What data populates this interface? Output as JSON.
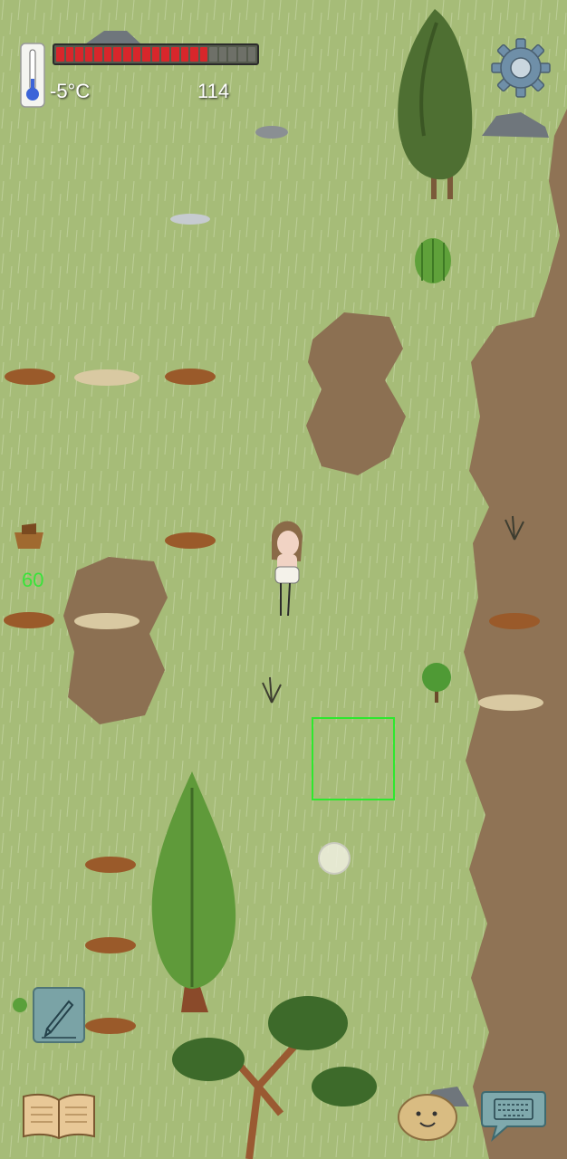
{
  "hud": {
    "temperature": "-5°C",
    "food_counter": "114",
    "health_fraction": 0.76,
    "health_segments_total": 21,
    "health_color": "#d8262b",
    "health_empty_color": "#6e7068"
  },
  "inventory": {
    "basket_count": "60"
  },
  "colors": {
    "grass": "#a7bd7a",
    "grass_light": "#c4d49a",
    "dirt": "#8f7355",
    "dirt_dark": "#6d553d",
    "target_outline": "#2ee82e"
  },
  "icons": {
    "settings": "gear-icon",
    "thermometer": "thermometer-icon",
    "draw": "pencil-icon",
    "journal": "book-icon",
    "emote": "potato-face-icon",
    "chat": "keyboard-icon"
  }
}
